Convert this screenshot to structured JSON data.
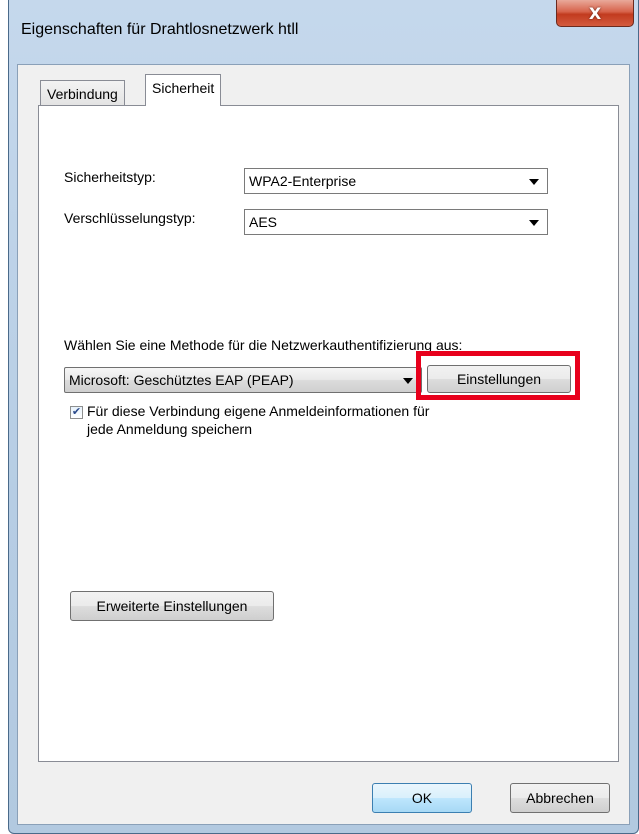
{
  "window": {
    "title": "Eigenschaften für Drahtlosnetzwerk htll",
    "close_glyph": "X"
  },
  "tabs": [
    {
      "label": "Verbindung",
      "active": false
    },
    {
      "label": "Sicherheit",
      "active": true
    }
  ],
  "security": {
    "security_type_label": "Sicherheitstyp:",
    "security_type_value": "WPA2-Enterprise",
    "encryption_type_label": "Verschlüsselungstyp:",
    "encryption_type_value": "AES",
    "auth_method_prompt": "Wählen Sie eine Methode für die Netzwerkauthentifizierung aus:",
    "auth_method_value": "Microsoft: Geschütztes EAP (PEAP)",
    "settings_button": "Einstellungen",
    "remember_checkbox_checked": true,
    "remember_line1": "Für diese Verbindung eigene Anmeldeinformationen für",
    "remember_line2": "jede Anmeldung speichern",
    "advanced_button": "Erweiterte Einstellungen"
  },
  "footer": {
    "ok_button": "OK",
    "cancel_button": "Abbrechen"
  },
  "colors": {
    "highlight": "#e8001c",
    "close_button": "#c23b1f"
  }
}
